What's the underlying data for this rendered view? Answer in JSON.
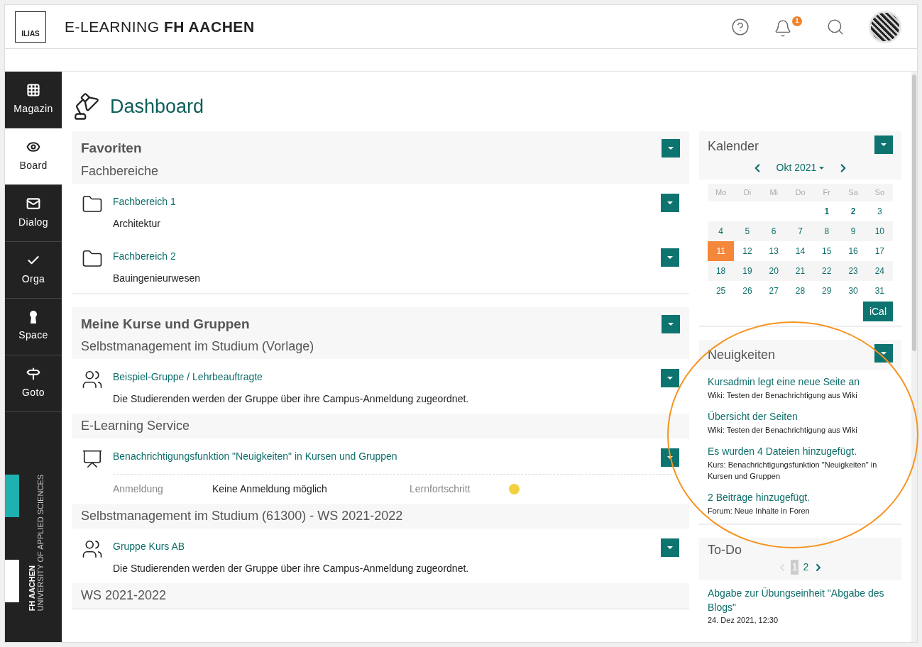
{
  "header": {
    "logo": "ILIAS",
    "title_light": "E-LEARNING",
    "title_bold": "FH AACHEN",
    "notification_count": "1"
  },
  "sidebar": {
    "items": [
      {
        "label": "Magazin",
        "selected": false
      },
      {
        "label": "Board",
        "selected": true
      },
      {
        "label": "Dialog",
        "selected": false
      },
      {
        "label": "Orga",
        "selected": false
      },
      {
        "label": "Space",
        "selected": false
      },
      {
        "label": "Goto",
        "selected": false
      }
    ],
    "brand": {
      "name": "FH AACHEN",
      "subtitle": "UNIVERSITY OF APPLIED SCIENCES"
    }
  },
  "page_title": "Dashboard",
  "favorites": {
    "title": "Favoriten",
    "groups": [
      {
        "heading": "Fachbereiche",
        "items": [
          {
            "kind": "folder",
            "title": "Fachbereich 1",
            "description": "Architektur"
          },
          {
            "kind": "folder",
            "title": "Fachbereich 2",
            "description": "Bauingenieurwesen"
          }
        ]
      }
    ]
  },
  "courses": {
    "title": "Meine Kurse und Gruppen",
    "groups": [
      {
        "heading": "Selbstmanagement im Studium (Vorlage)",
        "items": [
          {
            "kind": "group",
            "title": "Beispiel-Gruppe / Lehrbeauftragte",
            "description": "Die Studierenden werden der Gruppe über ihre Campus-Anmeldung zugeordnet."
          }
        ]
      },
      {
        "heading": "E-Learning Service",
        "items": [
          {
            "kind": "course",
            "title": "Benachrichtigungsfunktion \"Neuigkeiten\" in Kursen und Gruppen",
            "properties": [
              {
                "label": "Anmeldung",
                "value": "Keine Anmeldung möglich"
              }
            ],
            "progress_label": "Lernfortschritt"
          }
        ]
      },
      {
        "heading": "Selbstmanagement im Studium (61300) - WS 2021-2022",
        "items": [
          {
            "kind": "group",
            "title": "Gruppe Kurs AB",
            "description": "Die Studierenden werden der Gruppe über ihre Campus-Anmeldung zugeordnet."
          }
        ]
      },
      {
        "heading": "WS 2021-2022"
      }
    ]
  },
  "calendar": {
    "title": "Kalender",
    "month": "Okt 2021",
    "weekdays": [
      "Mo",
      "Di",
      "Mi",
      "Do",
      "Fr",
      "Sa",
      "So"
    ],
    "weeks": [
      [
        {
          "label": "1",
          "selected": false,
          "has_events": true
        },
        {
          "label": "2",
          "selected": false,
          "has_events": true
        },
        {
          "label": "3",
          "selected": false,
          "has_events": false
        }
      ],
      [
        {
          "label": "4",
          "selected": false,
          "has_events": false
        },
        {
          "label": "5",
          "selected": false,
          "has_events": false
        },
        {
          "label": "6",
          "selected": false,
          "has_events": false
        },
        {
          "label": "7",
          "selected": false,
          "has_events": false
        },
        {
          "label": "8",
          "selected": false,
          "has_events": false
        },
        {
          "label": "9",
          "selected": false,
          "has_events": false
        },
        {
          "label": "10",
          "selected": false,
          "has_events": false
        }
      ],
      [
        {
          "label": "11",
          "selected": true,
          "has_events": false
        },
        {
          "label": "12",
          "selected": false,
          "has_events": false
        },
        {
          "label": "13",
          "selected": false,
          "has_events": false
        },
        {
          "label": "14",
          "selected": false,
          "has_events": false
        },
        {
          "label": "15",
          "selected": false,
          "has_events": false
        },
        {
          "label": "16",
          "selected": false,
          "has_events": false
        },
        {
          "label": "17",
          "selected": false,
          "has_events": false
        }
      ],
      [
        {
          "label": "18",
          "selected": false,
          "has_events": false
        },
        {
          "label": "19",
          "selected": false,
          "has_events": false
        },
        {
          "label": "20",
          "selected": false,
          "has_events": false
        },
        {
          "label": "21",
          "selected": false,
          "has_events": false
        },
        {
          "label": "22",
          "selected": false,
          "has_events": false
        },
        {
          "label": "23",
          "selected": false,
          "has_events": false
        },
        {
          "label": "24",
          "selected": false,
          "has_events": false
        }
      ],
      [
        {
          "label": "25",
          "selected": false,
          "has_events": false
        },
        {
          "label": "26",
          "selected": false,
          "has_events": false
        },
        {
          "label": "27",
          "selected": false,
          "has_events": false
        },
        {
          "label": "28",
          "selected": false,
          "has_events": false
        },
        {
          "label": "29",
          "selected": false,
          "has_events": false
        },
        {
          "label": "30",
          "selected": false,
          "has_events": false
        },
        {
          "label": "31",
          "selected": false,
          "has_events": false
        }
      ]
    ],
    "export_button": "iCal"
  },
  "news": {
    "title": "Neuigkeiten",
    "items": [
      {
        "title": "Kursadmin legt eine neue Seite an",
        "subtitle": "Wiki: Testen der Benachrichtigung aus Wiki"
      },
      {
        "title": "Übersicht der Seiten",
        "subtitle": "Wiki: Testen der Benachrichtigung aus Wiki"
      },
      {
        "title": "Es wurden 4 Dateien hinzugefügt.",
        "subtitle": "Kurs: Benachrichtigungsfunktion \"Neuigkeiten\" in Kursen und Gruppen"
      },
      {
        "title": "2 Beiträge hinzugefügt.",
        "subtitle": "Forum: Neue Inhalte in Foren"
      }
    ]
  },
  "todo": {
    "title": "To-Do",
    "pages": [
      {
        "label": "1",
        "selected": true
      },
      {
        "label": "2",
        "selected": false
      }
    ],
    "items": [
      {
        "title": "Abgabe zur Übungseinheit \"Abgabe des Blogs\"",
        "date": "24. Dez 2021, 12:30"
      }
    ]
  }
}
